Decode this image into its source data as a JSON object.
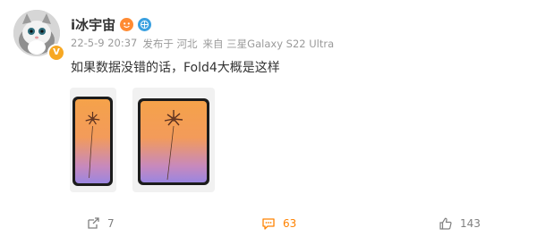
{
  "post": {
    "author": "i冰宇宙",
    "date": "22-5-9 20:37",
    "region": "发布于 河北",
    "source": "来自 三星Galaxy S22 Ultra",
    "text": "如果数据没错的话，Fold4大概是这样"
  },
  "actions": {
    "repost_count": "7",
    "comment_count": "63",
    "like_count": "143"
  },
  "colors": {
    "accent_orange": "#ff8200",
    "meta_gray": "#9a9a9a",
    "verified_yellow": "#f7a823"
  },
  "icons": [
    "avatar-cat",
    "verified-v-icon",
    "vip-emoji-icon",
    "globe-badge-icon",
    "repost-icon",
    "comment-icon",
    "like-icon"
  ]
}
